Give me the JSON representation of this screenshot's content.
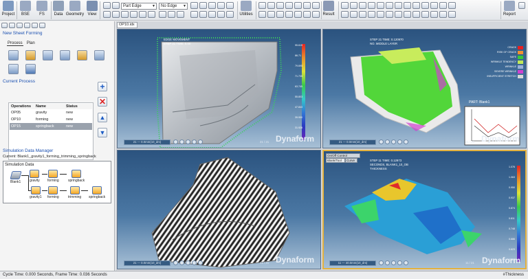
{
  "ribbon": {
    "buttons": [
      {
        "label": "Project",
        "icon": "project-icon",
        "color": "#7e9ac0"
      },
      {
        "label": "BSE",
        "icon": "bse-icon",
        "color": "#9aa9c2"
      },
      {
        "label": "FS",
        "icon": "fs-icon",
        "color": "#9aa9c2"
      },
      {
        "label": "Data",
        "icon": "data-icon",
        "color": "#8fa0b8"
      },
      {
        "label": "Geometry",
        "icon": "geometry-icon",
        "color": "#9aa9c2"
      },
      {
        "label": "View",
        "icon": "view-icon",
        "color": "#7a8fb0"
      },
      {
        "label": "Utilities",
        "icon": "utilities-icon",
        "color": "#9aa9c2"
      },
      {
        "label": "Result",
        "icon": "result-icon",
        "color": "#8a99b5"
      },
      {
        "label": "Report",
        "icon": "report-icon",
        "color": "#9aa9c2"
      }
    ],
    "combo_part_edge": "Part Edge",
    "combo_no_edge": "No Edge"
  },
  "left": {
    "panel_title": "New Sheet Forming",
    "tabs": [
      "Process",
      "Plan"
    ],
    "current_process_title": "Current Process",
    "columns": [
      "Operations",
      "Name",
      "Status"
    ],
    "rows": [
      {
        "op": "OP05",
        "name": "gravity",
        "status": "new"
      },
      {
        "op": "OP10",
        "name": "forming",
        "status": "new"
      },
      {
        "op": "OP15",
        "name": "springback",
        "status": "new"
      }
    ],
    "sdm_title": "Simulation Data Manager",
    "current_line": "Current: Blank1_gravity1_forming_trimming_springback",
    "sim_data_label": "Simulation Data",
    "nodes": {
      "blank": "Blank1",
      "gravity": "gravity",
      "forming": "forming",
      "springback": "springback",
      "gravity1": "gravity1",
      "forming2": "forming",
      "trimming": "trimming",
      "springback2": "springback"
    }
  },
  "viewport": {
    "doc_tab": "OP10.idx",
    "logo": "Dynaform",
    "v1": {
      "line1": "EDGE MOVEMENT",
      "line2": "STEP 21   TIME: 0.00",
      "legend": [
        "95.619",
        "86.71",
        "79.695",
        "71.735",
        "63.745",
        "55.803",
        "47.843",
        "39.900",
        "31.928",
        "23.918"
      ],
      "frame": "21 — 0.0mm(10_dm)",
      "count": "21 / 21"
    },
    "v2": {
      "line1": "STEP 21   TIME: 0.120970",
      "line2": "NO. MIDDLE LAYER",
      "legend": [
        "CRACK",
        "RISK OF CRACK",
        "SAFE",
        "WRINKLE TENDENCY",
        "WRINKLE",
        "SEVERE WRINKLE",
        "INSUFFICIENT STRETCH"
      ],
      "legend_colors": [
        "#e82020",
        "#f09030",
        "#38c838",
        "#c0e858",
        "#9ab0d8",
        "#d040d0",
        "#d8d8d8"
      ],
      "part_label": "PART: Blank1",
      "frame": "21 — 0.0mm(10_dm)",
      "count": "21 / 21"
    },
    "v4": {
      "btn_onoff": "On/Off Control",
      "tab1": "Blank/Tool",
      "tab2": "Curve",
      "line1": "STEP 11   TIME: 0.12973",
      "line2": "SECONDS, BLANK1_10_OB",
      "line3": "THICKNESS",
      "legend": [
        "1.076",
        "1.063",
        "0.950",
        "0.937",
        "0.874",
        "0.811",
        "0.748",
        "0.686",
        "0.623",
        "0.560"
      ],
      "frame": "11 — 40.0mm(10_dm)",
      "count": "11 / 21"
    },
    "v3": {
      "frame": "21 — 0.0mm(10_dm)",
      "count": "21 / 21"
    }
  },
  "status": {
    "left": "Cycle Time:  0.000 Seconds, Frame Time:  0.036 Seconds",
    "right": "#Thickness"
  }
}
